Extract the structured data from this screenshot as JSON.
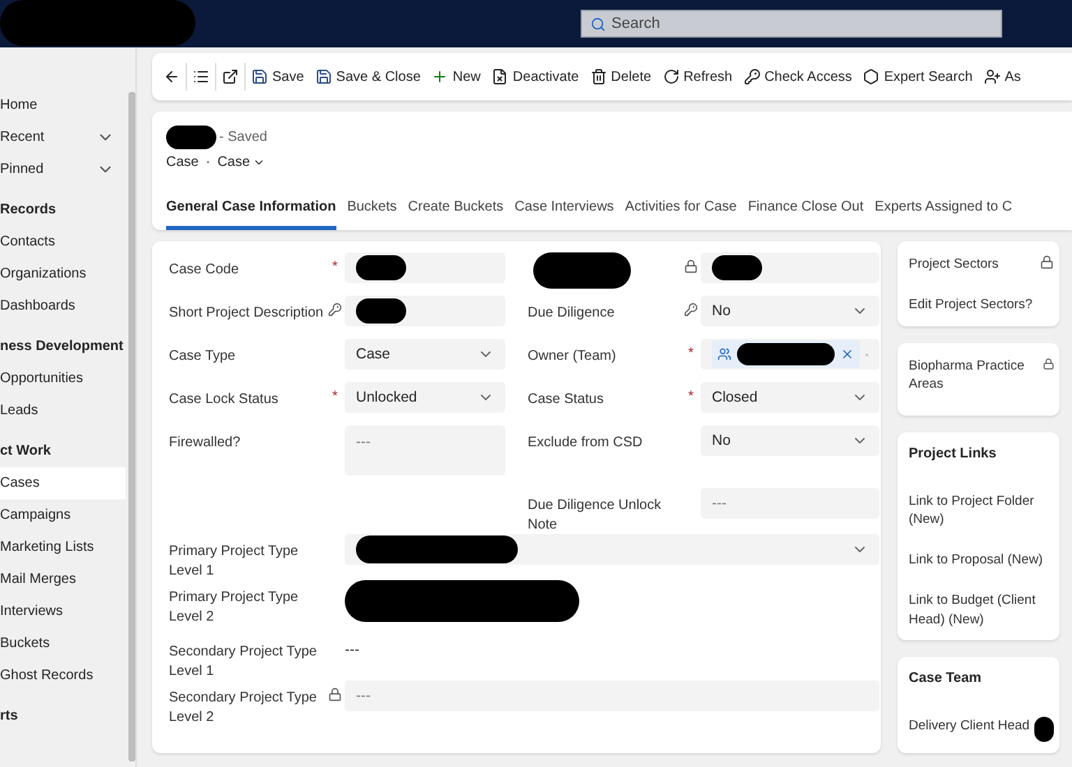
{
  "top_bar": {
    "search": {
      "placeholder": "Search"
    }
  },
  "sidebar": {
    "items": [
      {
        "kind": "item",
        "label": "Home",
        "selected": false,
        "expandable": false
      },
      {
        "kind": "item",
        "label": "Recent",
        "selected": false,
        "expandable": true
      },
      {
        "kind": "item",
        "label": "Pinned",
        "selected": false,
        "expandable": true
      },
      {
        "kind": "section",
        "label": "Records"
      },
      {
        "kind": "item",
        "label": "Contacts",
        "selected": false,
        "expandable": false
      },
      {
        "kind": "item",
        "label": "Organizations",
        "selected": false,
        "expandable": false
      },
      {
        "kind": "item",
        "label": "Dashboards",
        "selected": false,
        "expandable": false
      },
      {
        "kind": "section",
        "label": "ness Development"
      },
      {
        "kind": "item",
        "label": "Opportunities",
        "selected": false,
        "expandable": false
      },
      {
        "kind": "item",
        "label": "Leads",
        "selected": false,
        "expandable": false
      },
      {
        "kind": "section",
        "label": "ct Work"
      },
      {
        "kind": "item",
        "label": "Cases",
        "selected": true,
        "expandable": false
      },
      {
        "kind": "item",
        "label": "Campaigns",
        "selected": false,
        "expandable": false
      },
      {
        "kind": "item",
        "label": "Marketing Lists",
        "selected": false,
        "expandable": false
      },
      {
        "kind": "item",
        "label": "Mail Merges",
        "selected": false,
        "expandable": false
      },
      {
        "kind": "item",
        "label": "Interviews",
        "selected": false,
        "expandable": false
      },
      {
        "kind": "item",
        "label": "Buckets",
        "selected": false,
        "expandable": false
      },
      {
        "kind": "item",
        "label": "Ghost Records",
        "selected": false,
        "expandable": false
      },
      {
        "kind": "section",
        "label": "rts"
      }
    ]
  },
  "toolbar": {
    "buttons": [
      {
        "kind": "back"
      },
      {
        "kind": "list"
      },
      {
        "kind": "popout"
      },
      {
        "kind": "save",
        "label": "Save"
      },
      {
        "kind": "save_close",
        "label": "Save & Close"
      },
      {
        "kind": "new",
        "label": "New"
      },
      {
        "kind": "deactivate",
        "label": "Deactivate"
      },
      {
        "kind": "delete",
        "label": "Delete"
      },
      {
        "kind": "refresh",
        "label": "Refresh"
      },
      {
        "kind": "check_access",
        "label": "Check Access"
      },
      {
        "kind": "expert_search",
        "label": "Expert Search"
      },
      {
        "kind": "assign",
        "label": "As"
      }
    ]
  },
  "record": {
    "status": "- Saved",
    "entity": "Case",
    "separator": "·",
    "form": "Case"
  },
  "tabs": [
    {
      "label": "General Case Information",
      "selected": true
    },
    {
      "label": "Buckets",
      "selected": false
    },
    {
      "label": "Create Buckets",
      "selected": false
    },
    {
      "label": "Case Interviews",
      "selected": false
    },
    {
      "label": "Activities for Case",
      "selected": false
    },
    {
      "label": "Finance Close Out",
      "selected": false
    },
    {
      "label": "Experts Assigned to C",
      "selected": false
    }
  ],
  "form": {
    "rows": [
      {
        "left": {
          "label": "Case Code",
          "required_mark": "*",
          "kind": "text",
          "redacted": true
        },
        "right": {
          "label_redacted": true,
          "locked": true,
          "kind": "text",
          "redacted": true
        }
      },
      {
        "left": {
          "label": "Short Project Description",
          "keyed": true,
          "kind": "text",
          "redacted": true
        },
        "right": {
          "label": "Due Diligence",
          "keyed": true,
          "kind": "dropdown",
          "value": "No"
        }
      },
      {
        "left": {
          "label": "Case Type",
          "kind": "dropdown",
          "value": "Case"
        },
        "right": {
          "label": "Owner (Team)",
          "required_mark": "*",
          "kind": "lookup",
          "redacted": true
        }
      },
      {
        "left": {
          "label": "Case Lock Status",
          "required_mark": "*",
          "kind": "dropdown",
          "value": "Unlocked"
        },
        "right": {
          "label": "Case Status",
          "required_mark": "*",
          "kind": "dropdown",
          "value": "Closed"
        }
      },
      {
        "left": {
          "label": "Firewalled?",
          "kind": "textarea",
          "placeholder": "---"
        },
        "right": {
          "label": "Exclude from CSD",
          "kind": "dropdown",
          "value": "No"
        }
      },
      {
        "right": {
          "label": "Due Diligence Unlock Note",
          "kind": "text",
          "placeholder": "---"
        }
      },
      {
        "wide": {
          "label": "Primary Project Type Level 1",
          "kind": "dropdown",
          "redacted": true
        }
      },
      {
        "wide": {
          "label": "Primary Project Type Level 2",
          "kind": "plain",
          "redacted": true
        }
      },
      {
        "wide": {
          "label": "Secondary Project Type Level 1",
          "kind": "plain",
          "value": "---"
        }
      },
      {
        "wide": {
          "label": "Secondary Project Type Level 2",
          "locked": true,
          "kind": "text",
          "placeholder": "---"
        }
      }
    ]
  },
  "side_cards": [
    {
      "fields": [
        {
          "label": "Project Sectors",
          "locked": true
        },
        {
          "label": "Edit Project Sectors?"
        }
      ]
    },
    {
      "fields": [
        {
          "label": "Biopharma Practice Areas",
          "locked": true
        }
      ]
    },
    {
      "title": "Project Links",
      "fields": [
        {
          "label": "Link to Project Folder (New)"
        },
        {
          "label": "Link to Proposal (New)"
        },
        {
          "label": "Link to Budget (Client Head) (New)"
        }
      ]
    },
    {
      "title": "Case Team",
      "fields": [
        {
          "label": "Delivery Client Head",
          "redacted": true
        }
      ]
    }
  ]
}
